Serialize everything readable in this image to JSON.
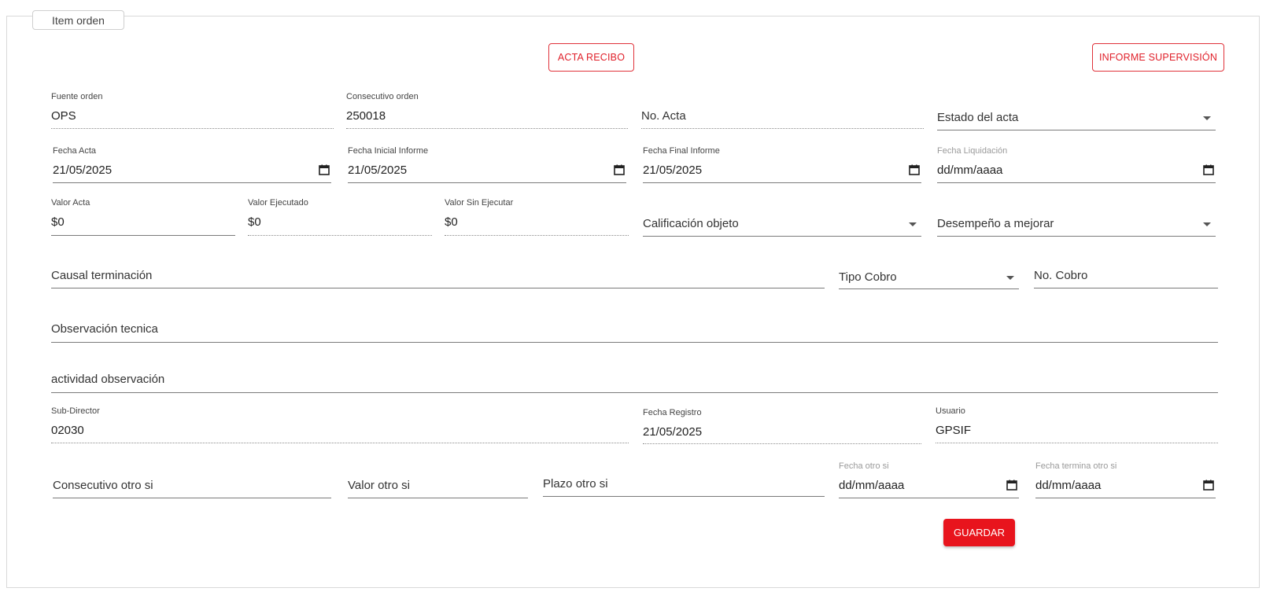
{
  "legend": "Item orden",
  "buttons": {
    "acta_recibo": "ACTA RECIBO",
    "informe_supervision": "INFORME SUPERVISIÓN",
    "guardar": "GUARDAR"
  },
  "fields": {
    "fuente_orden": {
      "label": "Fuente orden",
      "value": "OPS"
    },
    "consecutivo_orden": {
      "label": "Consecutivo orden",
      "value": "250018"
    },
    "no_acta": {
      "placeholder": "No. Acta"
    },
    "estado_acta": {
      "placeholder": "Estado del acta"
    },
    "fecha_acta": {
      "label": "Fecha Acta",
      "value": "21/05/2025"
    },
    "fecha_inicial_informe": {
      "label": "Fecha Inicial Informe",
      "value": "21/05/2025"
    },
    "fecha_final_informe": {
      "label": "Fecha Final Informe",
      "value": "21/05/2025"
    },
    "fecha_liquidacion": {
      "label": "Fecha Liquidación",
      "value": "dd/mm/aaaa"
    },
    "valor_acta": {
      "label": "Valor Acta",
      "value": "$0"
    },
    "valor_ejecutado": {
      "label": "Valor Ejecutado",
      "value": "$0"
    },
    "valor_sin_ejecutar": {
      "label": "Valor Sin Ejecutar",
      "value": "$0"
    },
    "calificacion_objeto": {
      "placeholder": "Calificación objeto"
    },
    "desempeno_mejorar": {
      "placeholder": "Desempeño a mejorar"
    },
    "causal_terminacion": {
      "placeholder": "Causal terminación"
    },
    "tipo_cobro": {
      "placeholder": "Tipo Cobro"
    },
    "no_cobro": {
      "placeholder": "No. Cobro"
    },
    "observacion_tecnica": {
      "placeholder": "Observación tecnica"
    },
    "actividad_observacion": {
      "placeholder": "actividad observación"
    },
    "sub_director": {
      "label": "Sub-Director",
      "value": "02030"
    },
    "fecha_registro": {
      "label": "Fecha Registro",
      "value": "21/05/2025"
    },
    "usuario": {
      "label": "Usuario",
      "value": "GPSIF"
    },
    "consecutivo_otro_si": {
      "placeholder": "Consecutivo otro si"
    },
    "valor_otro_si": {
      "placeholder": "Valor otro si"
    },
    "plazo_otro_si": {
      "placeholder": "Plazo otro si"
    },
    "fecha_otro_si": {
      "label": "Fecha otro si",
      "value": "dd/mm/aaaa"
    },
    "fecha_termina_otro_si": {
      "label": "Fecha termina otro si",
      "value": "dd/mm/aaaa"
    }
  },
  "colors": {
    "accent": "#e8141d",
    "outline": "#e0323a"
  }
}
